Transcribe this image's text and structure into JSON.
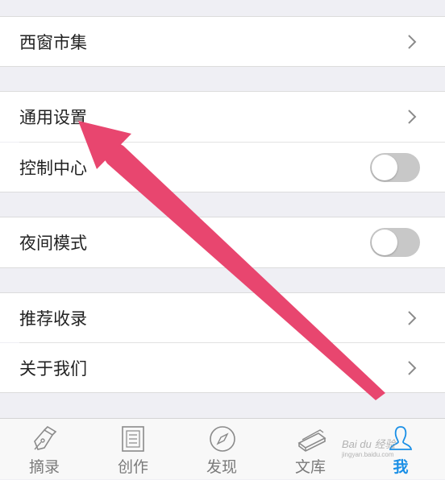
{
  "menu": {
    "market": "西窗市集",
    "general_settings": "通用设置",
    "control_center": "控制中心",
    "night_mode": "夜间模式",
    "recommend": "推荐收录",
    "about_us": "关于我们"
  },
  "toggles": {
    "control_center_on": false,
    "night_mode_on": false
  },
  "tabbar": {
    "excerpt": "摘录",
    "create": "创作",
    "discover": "发现",
    "library": "文库",
    "me": "我"
  },
  "watermark": {
    "text": "Bai du 经验",
    "sub": "jingyan.baidu.com"
  },
  "colors": {
    "accent": "#1a8fe6",
    "arrow": "#e8466f",
    "toggle_off": "#c8c8c8"
  },
  "icons": {
    "row_arrow": "chevron-right-icon",
    "excerpt": "pen-nib-icon",
    "create": "document-icon",
    "discover": "compass-icon",
    "library": "books-icon",
    "me": "person-icon"
  }
}
